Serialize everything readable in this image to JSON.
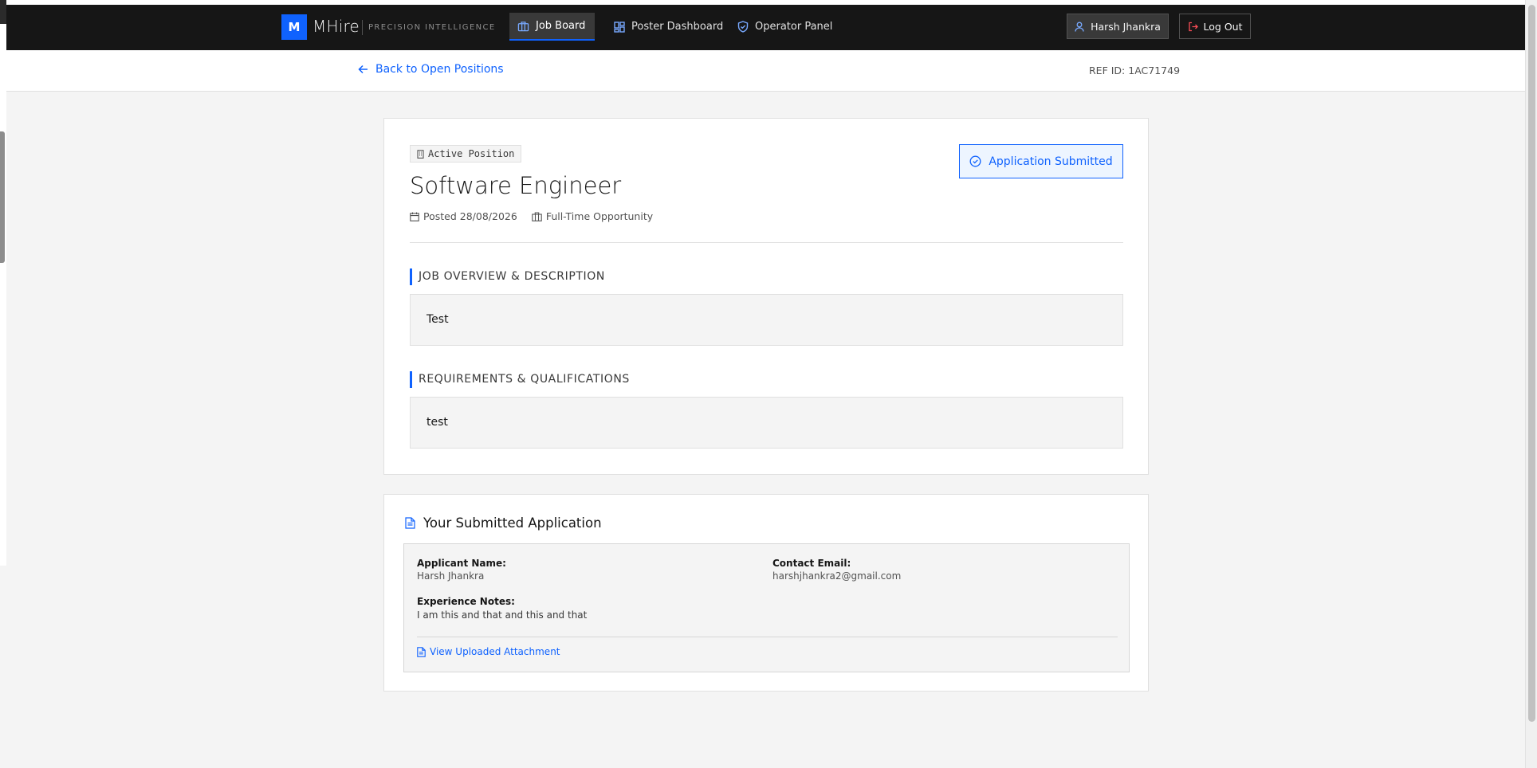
{
  "header": {
    "logo_letter": "M",
    "brand": "MHire",
    "tagline": "PRECISION INTELLIGENCE",
    "nav": [
      {
        "label": "Job Board",
        "icon": "briefcase-icon",
        "active": true
      },
      {
        "label": "Poster Dashboard",
        "icon": "dashboard-icon",
        "active": false
      },
      {
        "label": "Operator Panel",
        "icon": "shield-icon",
        "active": false
      }
    ],
    "user_name": "Harsh Jhankra",
    "logout_label": "Log Out"
  },
  "subheader": {
    "back_label": "Back to Open Positions",
    "ref_id": "REF ID: 1AC71749"
  },
  "job": {
    "status_tag": "Active Position",
    "title": "Software Engineer",
    "posted": "Posted 28/08/2026",
    "type": "Full-Time Opportunity",
    "applied_label": "Application Submitted",
    "overview_heading": "JOB OVERVIEW & DESCRIPTION",
    "overview_text": "Test",
    "requirements_heading": "REQUIREMENTS & QUALIFICATIONS",
    "requirements_text": "test"
  },
  "application": {
    "title": "Your Submitted Application",
    "name_label": "Applicant Name:",
    "name_value": "Harsh Jhankra",
    "email_label": "Contact Email:",
    "email_value": "harshjhankra2@gmail.com",
    "notes_label": "Experience Notes:",
    "notes_value": "I am this and that and this and that",
    "attachment_label": "View Uploaded Attachment"
  },
  "colors": {
    "accent": "#0f62fe",
    "header_bg": "#161616",
    "page_bg": "#f4f4f4"
  }
}
